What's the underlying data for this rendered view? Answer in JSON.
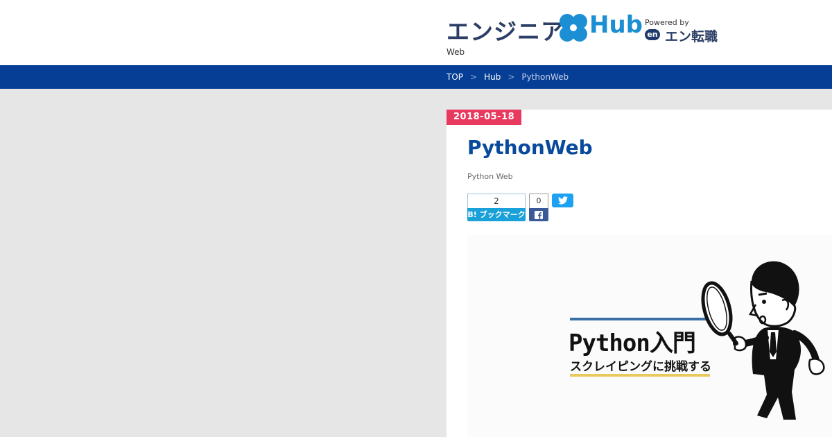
{
  "header": {
    "logo": {
      "text_main": "エンジニア",
      "text_hub": "Hub",
      "powered_by": "Powered by",
      "en_badge": "en",
      "en_name": "エン転職"
    },
    "tagline": "Web"
  },
  "nav": {
    "breadcrumb": [
      {
        "label": "TOP",
        "current": false
      },
      {
        "label": "Hub",
        "current": false
      },
      {
        "label": "PythonWeb",
        "current": true
      }
    ],
    "separator": ">"
  },
  "article": {
    "date": "2018-05-18",
    "title": "PythonWeb",
    "tags": "Python Web",
    "share": {
      "hatena_count": "2",
      "hatena_label": "B! ブックマーク",
      "facebook_count": "0"
    },
    "hero": {
      "title": "Python入門",
      "subtitle": "スクレイピングに挑戦する"
    }
  },
  "colors": {
    "navbar": "#063e95",
    "date_badge": "#e8395e",
    "title": "#0a4a9c",
    "hatena": "#1aa1d9",
    "facebook": "#3b5998",
    "twitter": "#1da1f2"
  },
  "icons": {
    "facebook": "facebook-icon",
    "twitter": "twitter-icon",
    "logo_mark": "clover-logo-icon"
  }
}
